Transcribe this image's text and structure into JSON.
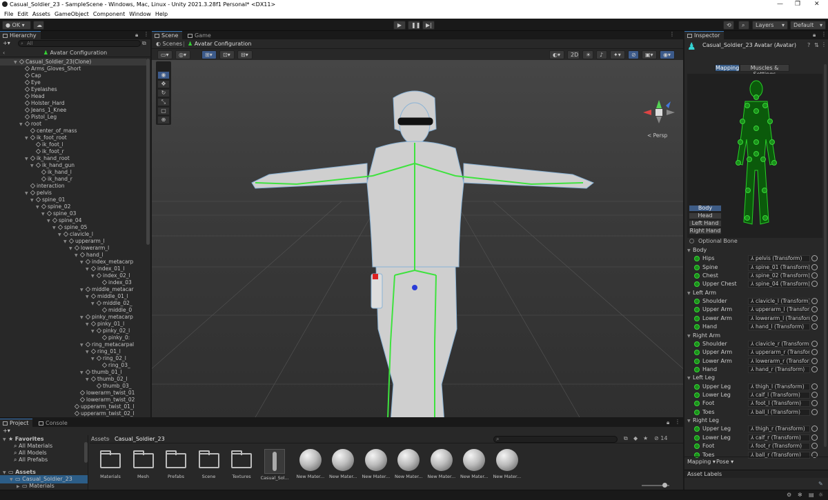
{
  "window": {
    "title": "Casual_Soldier_23 - SampleScene - Windows, Mac, Linux - Unity 2021.3.28f1 Personal* <DX11>"
  },
  "menu": [
    "File",
    "Edit",
    "Assets",
    "GameObject",
    "Component",
    "Window",
    "Help"
  ],
  "toolbar": {
    "account": "OK",
    "layers": "Layers",
    "layout": "Default"
  },
  "hierarchy": {
    "tab": "Hierarchy",
    "search_placeholder": "All",
    "header": "Avatar Configuration",
    "items": [
      {
        "label": "Casual_Soldier_23(Clone)",
        "depth": 0,
        "arrow": "down"
      },
      {
        "label": "Arms_Gloves_Short",
        "depth": 1
      },
      {
        "label": "Cap",
        "depth": 1
      },
      {
        "label": "Eye",
        "depth": 1
      },
      {
        "label": "Eyelashes",
        "depth": 1
      },
      {
        "label": "Head",
        "depth": 1
      },
      {
        "label": "Holster_Hard",
        "depth": 1
      },
      {
        "label": "Jeans_1_Knee",
        "depth": 1
      },
      {
        "label": "Pistol_Leg",
        "depth": 1
      },
      {
        "label": "root",
        "depth": 1,
        "arrow": "down"
      },
      {
        "label": "center_of_mass",
        "depth": 2
      },
      {
        "label": "ik_foot_root",
        "depth": 2,
        "arrow": "down"
      },
      {
        "label": "ik_foot_l",
        "depth": 3
      },
      {
        "label": "ik_foot_r",
        "depth": 3
      },
      {
        "label": "ik_hand_root",
        "depth": 2,
        "arrow": "down"
      },
      {
        "label": "ik_hand_gun",
        "depth": 3,
        "arrow": "down"
      },
      {
        "label": "ik_hand_l",
        "depth": 4
      },
      {
        "label": "ik_hand_r",
        "depth": 4
      },
      {
        "label": "interaction",
        "depth": 2
      },
      {
        "label": "pelvis",
        "depth": 2,
        "arrow": "down"
      },
      {
        "label": "spine_01",
        "depth": 3,
        "arrow": "down"
      },
      {
        "label": "spine_02",
        "depth": 4,
        "arrow": "down"
      },
      {
        "label": "spine_03",
        "depth": 5,
        "arrow": "down"
      },
      {
        "label": "spine_04",
        "depth": 6,
        "arrow": "down"
      },
      {
        "label": "spine_05",
        "depth": 7,
        "arrow": "down"
      },
      {
        "label": "clavicle_l",
        "depth": 8,
        "arrow": "down"
      },
      {
        "label": "upperarm_l",
        "depth": 9,
        "arrow": "down"
      },
      {
        "label": "lowerarm_l",
        "depth": 10,
        "arrow": "down"
      },
      {
        "label": "hand_l",
        "depth": 11,
        "arrow": "down"
      },
      {
        "label": "index_metacarp",
        "depth": 12,
        "arrow": "down"
      },
      {
        "label": "index_01_l",
        "depth": 13,
        "arrow": "down"
      },
      {
        "label": "index_02_l",
        "depth": 14,
        "arrow": "down"
      },
      {
        "label": "index_03",
        "depth": 15
      },
      {
        "label": "middle_metacar",
        "depth": 12,
        "arrow": "down"
      },
      {
        "label": "middle_01_l",
        "depth": 13,
        "arrow": "down"
      },
      {
        "label": "middle_02_",
        "depth": 14,
        "arrow": "down"
      },
      {
        "label": "middle_0",
        "depth": 15
      },
      {
        "label": "pinky_metacarp",
        "depth": 12,
        "arrow": "down"
      },
      {
        "label": "pinky_01_l",
        "depth": 13,
        "arrow": "down"
      },
      {
        "label": "pinky_02_l",
        "depth": 14,
        "arrow": "down"
      },
      {
        "label": "pinky_0:",
        "depth": 15
      },
      {
        "label": "ring_metacarpal",
        "depth": 12,
        "arrow": "down"
      },
      {
        "label": "ring_01_l",
        "depth": 13,
        "arrow": "down"
      },
      {
        "label": "ring_02_l",
        "depth": 14,
        "arrow": "down"
      },
      {
        "label": "ring_03_",
        "depth": 15
      },
      {
        "label": "thumb_01_l",
        "depth": 12,
        "arrow": "down"
      },
      {
        "label": "thumb_02_l",
        "depth": 13,
        "arrow": "down"
      },
      {
        "label": "thumb_03_",
        "depth": 14
      },
      {
        "label": "lowerarm_twist_01",
        "depth": 11
      },
      {
        "label": "lowerarm_twist_02",
        "depth": 11
      },
      {
        "label": "upperarm_twist_01_l",
        "depth": 10
      },
      {
        "label": "upperarm_twist_02_l",
        "depth": 10
      }
    ]
  },
  "scene": {
    "tabs": [
      "Scene",
      "Game"
    ],
    "breadcrumb": [
      "Scenes",
      "Avatar Configuration"
    ],
    "gizmo_label": "< Persp",
    "btn_2d": "2D"
  },
  "project": {
    "tabs": [
      "Project",
      "Console"
    ],
    "favorites": {
      "title": "Favorites",
      "items": [
        "All Materials",
        "All Models",
        "All Prefabs"
      ]
    },
    "assets_root": "Assets",
    "tree": [
      "Casual_Soldier_23",
      "Materials"
    ],
    "breadcrumb": [
      "Assets",
      "Casual_Soldier_23"
    ],
    "hidden_count": "14",
    "items": [
      {
        "label": "Materials",
        "kind": "folder"
      },
      {
        "label": "Mesh",
        "kind": "folder"
      },
      {
        "label": "Prefabs",
        "kind": "folder"
      },
      {
        "label": "Scene",
        "kind": "folder"
      },
      {
        "label": "Textures",
        "kind": "folder"
      },
      {
        "label": "Casual_Sol...",
        "kind": "model"
      },
      {
        "label": "New Mater...",
        "kind": "material"
      },
      {
        "label": "New Mater...",
        "kind": "material"
      },
      {
        "label": "New Mater...",
        "kind": "material"
      },
      {
        "label": "New Mater...",
        "kind": "material"
      },
      {
        "label": "New Mater...",
        "kind": "material"
      },
      {
        "label": "New Mater...",
        "kind": "material"
      },
      {
        "label": "New Mater...",
        "kind": "material"
      }
    ]
  },
  "inspector": {
    "tab": "Inspector",
    "title": "Casual_Soldier_23 Avatar (Avatar)",
    "tabs": [
      "Mapping",
      "Muscles & Settings"
    ],
    "body_parts": [
      "Body",
      "Head",
      "Left Hand",
      "Right Hand"
    ],
    "optional_bone": "Optional Bone",
    "groups": [
      {
        "name": "Body",
        "bones": [
          [
            "Hips",
            "pelvis (Transform)"
          ],
          [
            "Spine",
            "spine_01 (Transform)"
          ],
          [
            "Chest",
            "spine_02 (Transform)"
          ],
          [
            "Upper Chest",
            "spine_04 (Transform)"
          ]
        ]
      },
      {
        "name": "Left Arm",
        "bones": [
          [
            "Shoulder",
            "clavicle_l (Transform)"
          ],
          [
            "Upper Arm",
            "upperarm_l (Transform)"
          ],
          [
            "Lower Arm",
            "lowerarm_l (Transform)"
          ],
          [
            "Hand",
            "hand_l (Transform)"
          ]
        ]
      },
      {
        "name": "Right Arm",
        "bones": [
          [
            "Shoulder",
            "clavicle_r (Transform)"
          ],
          [
            "Upper Arm",
            "upperarm_r (Transform)"
          ],
          [
            "Lower Arm",
            "lowerarm_r (Transform)"
          ],
          [
            "Hand",
            "hand_r (Transform)"
          ]
        ]
      },
      {
        "name": "Left Leg",
        "bones": [
          [
            "Upper Leg",
            "thigh_l (Transform)"
          ],
          [
            "Lower Leg",
            "calf_l (Transform)"
          ],
          [
            "Foot",
            "foot_l (Transform)"
          ],
          [
            "Toes",
            "ball_l (Transform)"
          ]
        ]
      },
      {
        "name": "Right Leg",
        "bones": [
          [
            "Upper Leg",
            "thigh_r (Transform)"
          ],
          [
            "Lower Leg",
            "calf_r (Transform)"
          ],
          [
            "Foot",
            "foot_r (Transform)"
          ],
          [
            "Toes",
            "ball_r (Transform)"
          ]
        ]
      }
    ],
    "footer": {
      "mapping": "Mapping",
      "pose": "Pose"
    },
    "asset_labels": "Asset Labels"
  },
  "colors": {
    "accent": "#3a79bb",
    "bone": "#3ee23e",
    "selection": "#2c5d87"
  }
}
